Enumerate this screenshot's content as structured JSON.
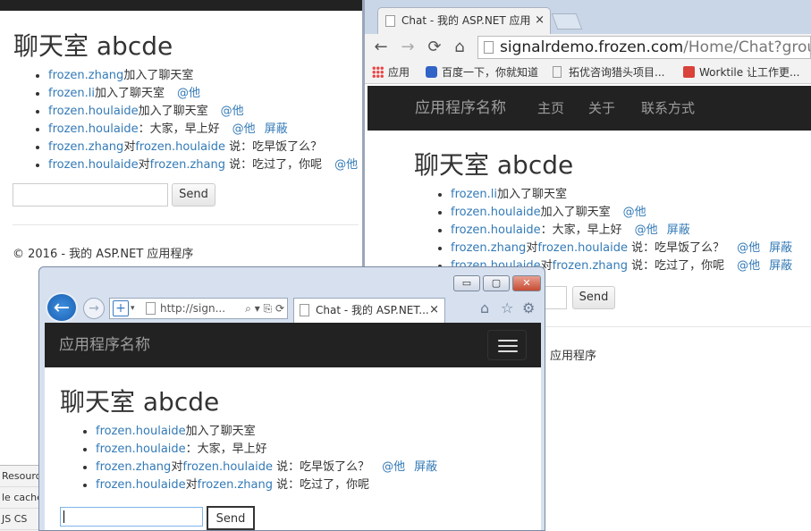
{
  "windowA": {
    "room_title": "聊天室 abcde",
    "messages": [
      {
        "user": "frozen.zhang",
        "text": "加入了聊天室",
        "at": "",
        "block": ""
      },
      {
        "user": "frozen.li",
        "text": "加入了聊天室",
        "at": "@他",
        "block": ""
      },
      {
        "user": "frozen.houlaide",
        "text": "加入了聊天室",
        "at": "@他",
        "block": ""
      },
      {
        "user": "frozen.houlaide",
        "text": "：大家，早上好",
        "at": "@他",
        "block": "屏蔽"
      },
      {
        "user": "frozen.zhang",
        "mid": "对",
        "target": "frozen.houlaide",
        "text": " 说：吃早饭了么？",
        "at": "",
        "block": ""
      },
      {
        "user": "frozen.houlaide",
        "mid": "对",
        "target": "frozen.zhang",
        "text": " 说：吃过了，你呢",
        "at": "@他",
        "block": ""
      }
    ],
    "input_value": "",
    "send_label": "Send",
    "footer": "© 2016 - 我的 ASP.NET 应用程序"
  },
  "devtools": {
    "rows": [
      "Resourc",
      "le cache",
      "JS  CS"
    ]
  },
  "windowB": {
    "tab_title": "Chat - 我的 ASP.NET 应用",
    "tab_close": "×",
    "url_host": "signalrdemo.frozen.com",
    "url_path": "/Home/Chat?groupN",
    "bookmarks": [
      "应用",
      "百度一下，你就知道",
      "拓优咨询猎头项目...",
      "Worktile 让工作更..."
    ],
    "nav": {
      "brand": "应用程序名称",
      "links": [
        "主页",
        "关于",
        "联系方式"
      ]
    },
    "room_title": "聊天室 abcde",
    "messages": [
      {
        "user": "frozen.li",
        "text": "加入了聊天室",
        "at": "",
        "block": ""
      },
      {
        "user": "frozen.houlaide",
        "text": "加入了聊天室",
        "at": "@他",
        "block": ""
      },
      {
        "user": "frozen.houlaide",
        "text": "：大家，早上好",
        "at": "@他",
        "block": "屏蔽"
      },
      {
        "user": "frozen.zhang",
        "mid": "对",
        "target": "frozen.houlaide",
        "text": " 说：吃早饭了么？",
        "at": "@他",
        "block": "屏蔽"
      },
      {
        "user": "frozen.houlaide",
        "mid": "对",
        "target": "frozen.zhang",
        "text": " 说：吃过了，你呢",
        "at": "@他",
        "block": "屏蔽"
      }
    ],
    "send_label": "Send",
    "footer_fragment": "应用程序"
  },
  "windowC": {
    "controls": {
      "minimize": "▭",
      "maximize": "▢",
      "close": "✕"
    },
    "address": "http://sign...",
    "tab_title": "Chat - 我的 ASP.NET...",
    "tab_close": "×",
    "nav_brand": "应用程序名称",
    "room_title": "聊天室 abcde",
    "messages": [
      {
        "user": "frozen.houlaide",
        "text": "加入了聊天室",
        "at": "",
        "block": ""
      },
      {
        "user": "frozen.houlaide",
        "text": "：大家，早上好",
        "at": "",
        "block": ""
      },
      {
        "user": "frozen.zhang",
        "mid": "对",
        "target": "frozen.houlaide",
        "text": " 说：吃早饭了么？",
        "at": "@他",
        "block": "屏蔽"
      },
      {
        "user": "frozen.houlaide",
        "mid": "对",
        "target": "frozen.zhang",
        "text": " 说：吃过了，你呢",
        "at": "",
        "block": ""
      }
    ],
    "input_value": "",
    "send_label": "Send"
  }
}
